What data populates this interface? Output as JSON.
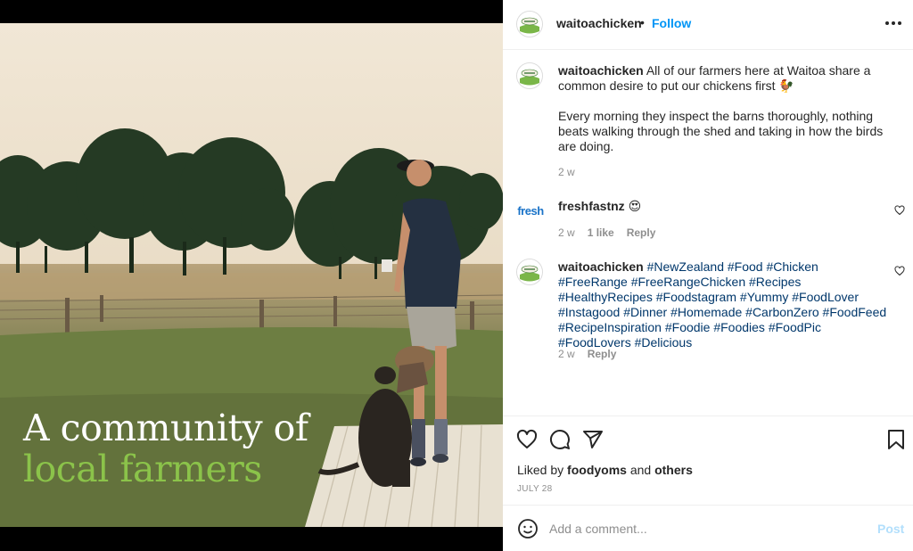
{
  "media": {
    "overlay_line1": "A community of",
    "overlay_line2": "local farmers",
    "colors": {
      "overlay_white": "#ffffff",
      "overlay_green": "#8bc34a"
    }
  },
  "header": {
    "username": "waitoachicken",
    "separator": "•",
    "follow_label": "Follow",
    "more_icon": "more-horizontal-icon",
    "follow_color": "#0095f6"
  },
  "caption": {
    "username": "waitoachicken",
    "text_line1": "All of our farmers here at Waitoa share a common desire to put our chickens first 🐓",
    "text_line2": "Every morning they inspect the barns thoroughly, nothing beats walking through the shed and taking in how the birds are doing.",
    "time": "2 w"
  },
  "comments": [
    {
      "username": "freshfastnz",
      "avatar_text": "fresh",
      "text": "😍",
      "time": "2 w",
      "likes": "1 like",
      "reply_label": "Reply"
    },
    {
      "username": "waitoachicken",
      "hashtags": [
        "#NewZealand",
        "#Food",
        "#Chicken",
        "#FreeRange",
        "#FreeRangeChicken",
        "#Recipes",
        "#HealthyRecipes",
        "#Foodstagram",
        "#Yummy",
        "#FoodLover",
        "#Instagood",
        "#Dinner",
        "#Homemade",
        "#CarbonZero",
        "#FoodFeed",
        "#RecipeInspiration",
        "#Foodie",
        "#Foodies",
        "#FoodPic",
        "#FoodLovers",
        "#Delicious"
      ],
      "time": "2 w",
      "reply_label": "Reply"
    }
  ],
  "actions": {
    "icons": [
      "heart-icon",
      "comment-icon",
      "share-icon",
      "bookmark-icon"
    ],
    "liked_prefix": "Liked by",
    "liked_user": "foodyoms",
    "liked_and": "and",
    "liked_others": "others",
    "date": "JULY 28"
  },
  "add_comment": {
    "placeholder": "Add a comment...",
    "post_label": "Post",
    "emoji_icon": "emoji-icon"
  }
}
